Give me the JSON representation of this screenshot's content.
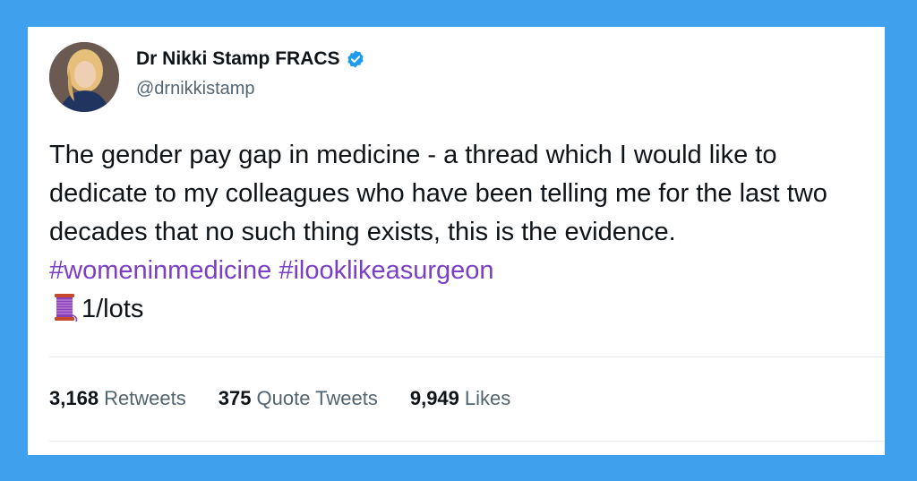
{
  "author": {
    "display_name": "Dr Nikki Stamp FRACS",
    "handle": "@drnikkistamp",
    "verified": true,
    "avatar_icon": "profile-photo"
  },
  "tweet": {
    "text_main": "The gender pay gap in medicine - a thread which I would like to dedicate to my colleagues who have been telling me for the last two decades that no such thing exists, this is the evidence.",
    "hashtags": [
      "#womeninmedicine",
      "#ilooklikeasurgeon"
    ],
    "thread_icon": "spool-of-thread-icon",
    "thread_marker": "1/lots"
  },
  "stats": [
    {
      "count": "3,168",
      "label": "Retweets"
    },
    {
      "count": "375",
      "label": "Quote Tweets"
    },
    {
      "count": "9,949",
      "label": "Likes"
    }
  ],
  "colors": {
    "background": "#3fa0ee",
    "card": "#ffffff",
    "hashtag": "#7b3fc7",
    "verified": "#1d9bf0"
  }
}
